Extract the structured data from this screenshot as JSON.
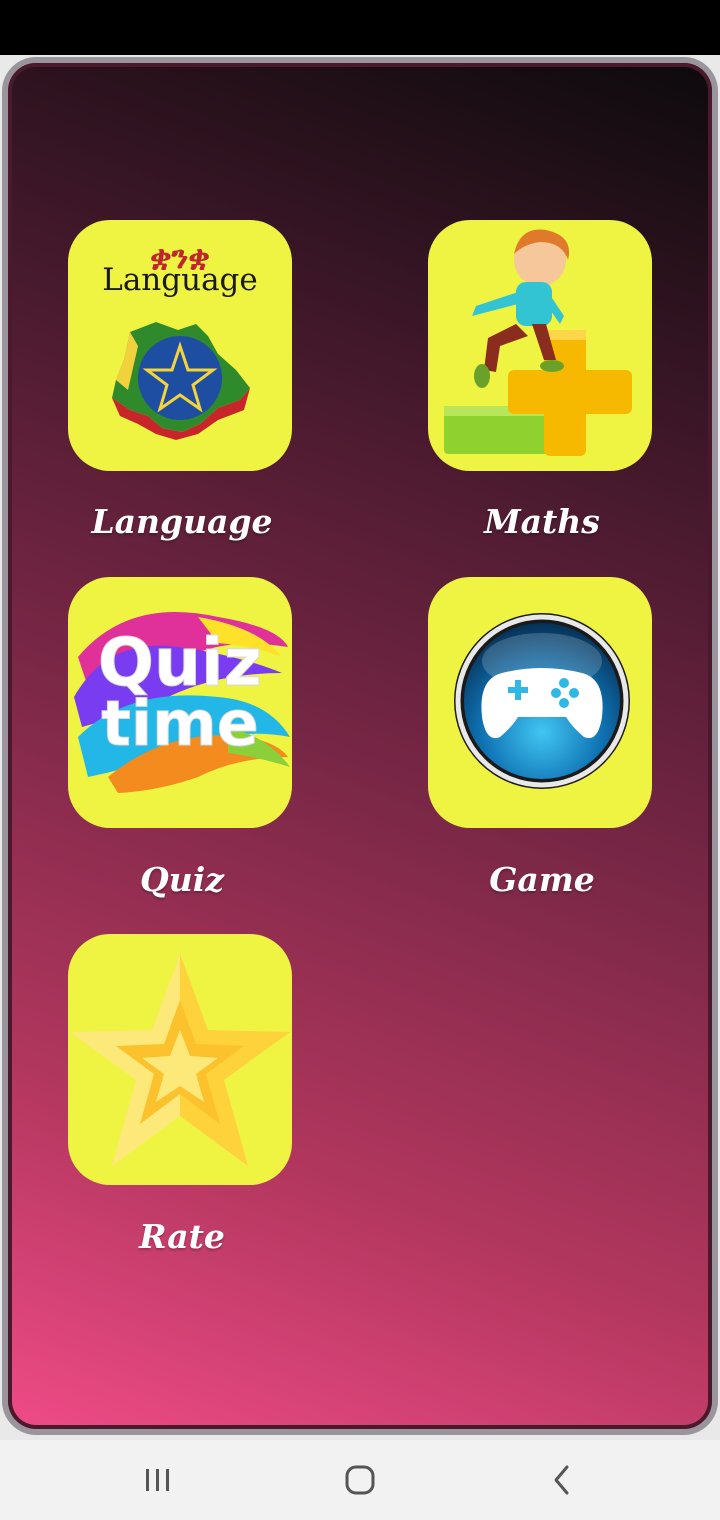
{
  "menu": {
    "items": [
      {
        "id": "language",
        "label": "Language",
        "tile_text": "Language",
        "tile_script": "ቋንቋ",
        "icon": "ethiopia-map-icon"
      },
      {
        "id": "maths",
        "label": "Maths",
        "icon": "child-plus-sign-icon"
      },
      {
        "id": "quiz",
        "label": "Quiz",
        "tile_text_line1": "Quiz",
        "tile_text_line2": "time",
        "icon": "quiz-time-icon"
      },
      {
        "id": "game",
        "label": "Game",
        "icon": "gamepad-icon"
      },
      {
        "id": "rate",
        "label": "Rate",
        "icon": "star-icon"
      }
    ]
  },
  "colors": {
    "tile_bg": "#eff341",
    "gradient_top": "#0c0a0c",
    "gradient_bottom": "#ef4b86",
    "label_text": "#ffffff"
  },
  "navigation": {
    "recents": "recents-icon",
    "home": "home-icon",
    "back": "back-icon"
  }
}
